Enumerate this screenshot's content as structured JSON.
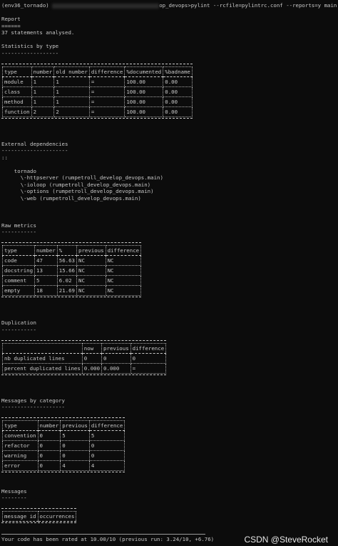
{
  "prompt": {
    "env": "(env36_tornado)",
    "path_end": "op_devops>",
    "command": "pylint --rcfile=pylintrc.conf --reports=y main.py"
  },
  "report": {
    "title": "Report",
    "underline": "======",
    "analysed": "37 statements analysed."
  },
  "stats_by_type": {
    "title": "Statistics by type",
    "underline": "------------------",
    "headers": [
      "type",
      "number",
      "old number",
      "difference",
      "%documented",
      "%badname"
    ],
    "rows": [
      [
        "module",
        "1",
        "1",
        "=",
        "100.00",
        "0.00"
      ],
      [
        "class",
        "1",
        "1",
        "=",
        "100.00",
        "0.00"
      ],
      [
        "method",
        "1",
        "1",
        "=",
        "100.00",
        "0.00"
      ],
      [
        "function",
        "2",
        "2",
        "=",
        "100.00",
        "0.00"
      ]
    ]
  },
  "external_deps": {
    "title": "External dependencies",
    "underline": "---------------------",
    "marker": "::",
    "lines": [
      "    tornado",
      "      \\-httpserver (rumpetroll_develop_devops.main)",
      "      \\-ioloop (rumpetroll_develop_devops.main)",
      "      \\-options (rumpetroll_develop_devops.main)",
      "      \\-web (rumpetroll_develop_devops.main)"
    ]
  },
  "raw_metrics": {
    "title": "Raw metrics",
    "underline": "-----------",
    "headers": [
      "type",
      "number",
      "%",
      "previous",
      "difference"
    ],
    "rows": [
      [
        "code",
        "47",
        "56.63",
        "NC",
        "NC"
      ],
      [
        "docstring",
        "13",
        "15.66",
        "NC",
        "NC"
      ],
      [
        "comment",
        "5",
        "6.02",
        "NC",
        "NC"
      ],
      [
        "empty",
        "18",
        "21.69",
        "NC",
        "NC"
      ]
    ]
  },
  "duplication": {
    "title": "Duplication",
    "underline": "-----------",
    "headers": [
      "",
      "now",
      "previous",
      "difference"
    ],
    "rows": [
      [
        "nb duplicated lines",
        "0",
        "0",
        "0"
      ],
      [
        "percent duplicated lines",
        "0.000",
        "0.000",
        "="
      ]
    ]
  },
  "messages_by_category": {
    "title": "Messages by category",
    "underline": "--------------------",
    "headers": [
      "type",
      "number",
      "previous",
      "difference"
    ],
    "rows": [
      [
        "convention",
        "0",
        "5",
        "5"
      ],
      [
        "refactor",
        "0",
        "0",
        "0"
      ],
      [
        "warning",
        "0",
        "0",
        "0"
      ],
      [
        "error",
        "0",
        "4",
        "4"
      ]
    ]
  },
  "messages": {
    "title": "Messages",
    "underline": "--------",
    "headers": [
      "message id",
      "occurrences"
    ]
  },
  "footer": {
    "rating": "Your code has been rated at 10.00/10 (previous run: 3.24/10, +6.76)"
  },
  "watermark": "CSDN @SteveRocket"
}
